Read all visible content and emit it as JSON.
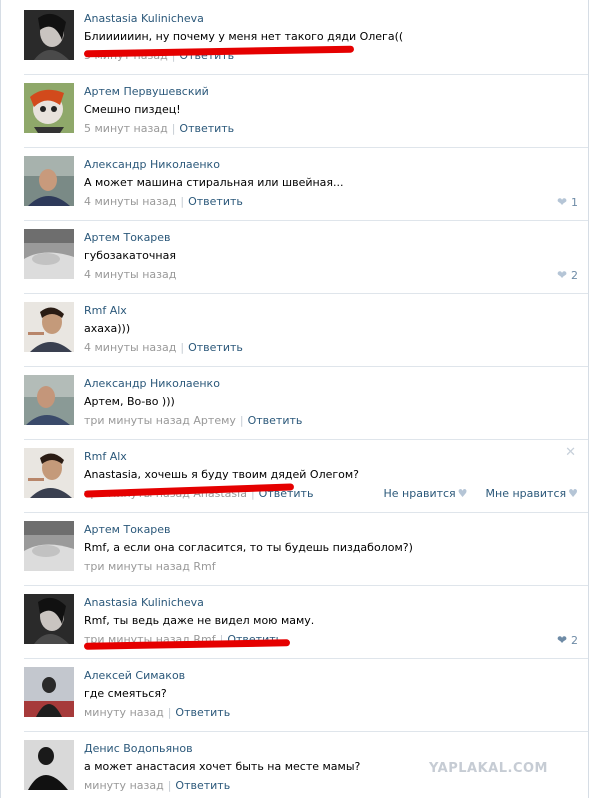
{
  "comments": [
    {
      "author": "Anastasia Kulinicheva",
      "text": "Блиииииин, ну почему у меня нет такого дяди Олега((",
      "time": "5 минут назад",
      "reply": "Ответить",
      "likes": ""
    },
    {
      "author": "Артем Первушевский",
      "text": "Смешно пиздец!",
      "time": "5 минут назад",
      "reply": "Ответить",
      "likes": ""
    },
    {
      "author": "Александр Николаенко",
      "text": "А может машина стиральная или швейная...",
      "time": "4 минуты назад",
      "reply": "Ответить",
      "likes": "1"
    },
    {
      "author": "Артем Токарев",
      "text": "губозакаточная",
      "time": "4 минуты назад",
      "reply": "",
      "likes": "2"
    },
    {
      "author": "Rmf Alx",
      "text": "ахаха)))",
      "time": "4 минуты назад",
      "reply": "Ответить",
      "likes": ""
    },
    {
      "author": "Александр Николаенко",
      "text": "Артем, Во-во )))",
      "time": "три минуты назад Артему",
      "reply": "Ответить",
      "likes": ""
    },
    {
      "author": "Rmf Alx",
      "text": "Anastasia, хочешь я буду твоим дядей Олегом?",
      "time": "три минуты назад Anastasia",
      "reply": "Ответить",
      "likes": "",
      "dislike": "Не нравится",
      "like": "Мне нравится"
    },
    {
      "author": "Артем Токарев",
      "text": "Rmf, а если она согласится, то ты будешь пиздаболом?)",
      "time": "три минуты назад Rmf",
      "reply": "",
      "likes": ""
    },
    {
      "author": "Anastasia Kulinicheva",
      "text": "Rmf, ты ведь даже не видел мою маму.",
      "time": "три минуты назад Rmf",
      "reply": "Ответить",
      "likes": "2"
    },
    {
      "author": "Алексей Симаков",
      "text": "где смеяться?",
      "time": "минуту назад",
      "reply": "Ответить",
      "likes": ""
    },
    {
      "author": "Денис Водопьянов",
      "text": "а может анастасия хочет быть на месте мамы?",
      "time": "минуту назад",
      "reply": "Ответить",
      "likes": ""
    }
  ],
  "watermark": "YAPLAKAL.COM",
  "colors": {
    "link": "#2b587a",
    "meta": "#999999",
    "marker": "#e50000"
  }
}
